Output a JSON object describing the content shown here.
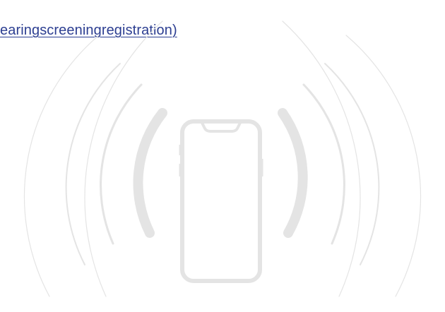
{
  "content": {
    "link_text": "earingscreeningregistration)",
    "illustration_icon": "phone-ringing-icon"
  },
  "colors": {
    "link": "#2c3e91",
    "illustration": "#e8e8e8",
    "background": "#ffffff"
  }
}
